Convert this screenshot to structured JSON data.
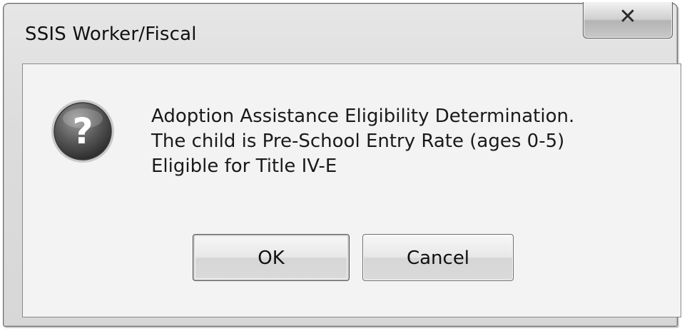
{
  "dialog": {
    "title": "SSIS Worker/Fiscal",
    "close_icon": "close-icon",
    "icon": "question-icon",
    "message_lines": [
      "Adoption Assistance Eligibility Determination.",
      "The child is Pre-School Entry Rate (ages 0-5)",
      "Eligible for Title IV-E"
    ],
    "buttons": {
      "ok_label": "OK",
      "cancel_label": "Cancel"
    }
  }
}
